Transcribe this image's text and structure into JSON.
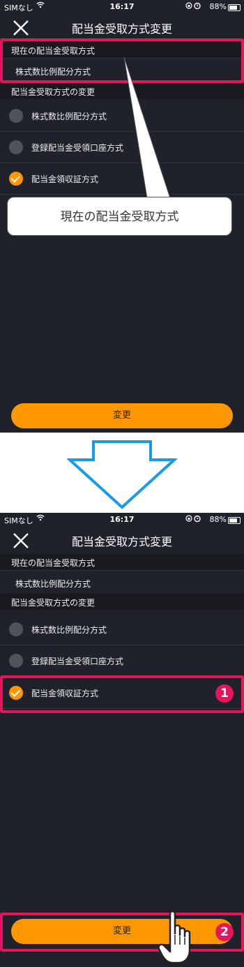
{
  "status_bar": {
    "carrier": "SIMなし",
    "time": "16:17",
    "battery": "88%"
  },
  "header": {
    "title": "配当金受取方式変更"
  },
  "current_section": {
    "header": "現在の配当金受取方式",
    "value": "株式数比例配分方式"
  },
  "change_section": {
    "header": "配当金受取方式の変更",
    "options": [
      {
        "label": "株式数比例配分方式",
        "checked": false
      },
      {
        "label": "登録配当金受領口座方式",
        "checked": false
      },
      {
        "label": "配当金領収証方式",
        "checked": true
      }
    ]
  },
  "button": {
    "label": "変更"
  },
  "callout": {
    "text": "現在の配当金受取方式"
  },
  "steps": {
    "step1": "1",
    "step2": "2"
  },
  "colors": {
    "accent": "#ff9800",
    "highlight": "#e3165b",
    "background": "#20222b",
    "arrow": "#1a9be8"
  },
  "icons": [
    "close-icon",
    "wifi-icon",
    "lock-icon",
    "alarm-icon",
    "battery-icon",
    "arrow-down-icon",
    "hand-pointer-icon"
  ]
}
